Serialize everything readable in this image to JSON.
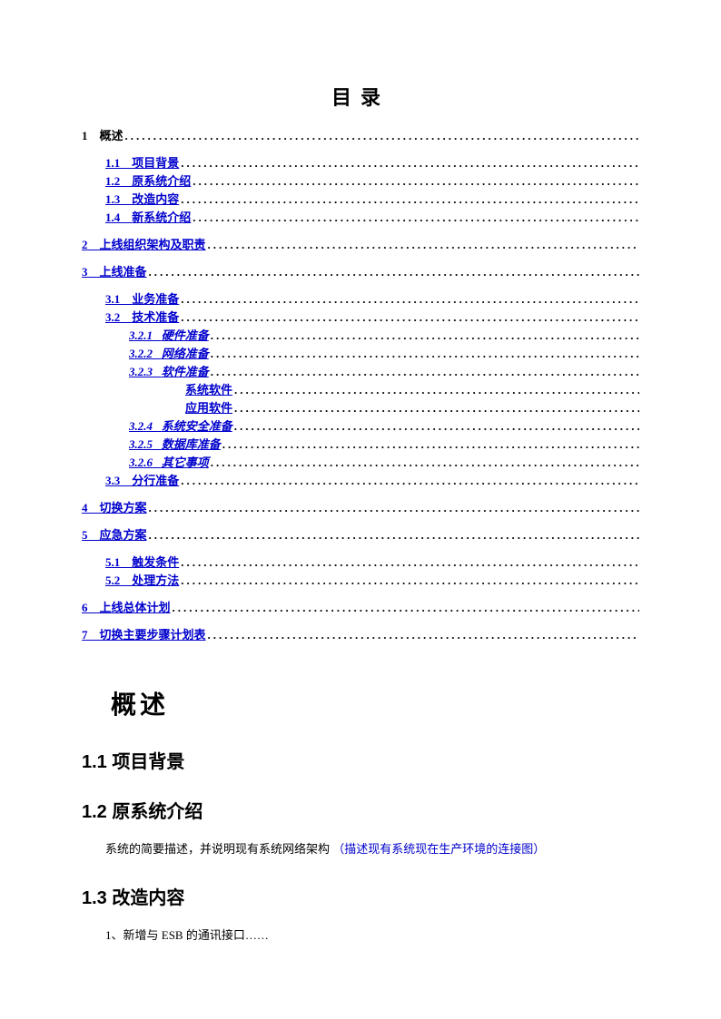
{
  "toc_title": "目录",
  "toc": [
    {
      "num": "1",
      "label": "概述",
      "indent": 0,
      "plain": true,
      "italic": false
    },
    {
      "num": "1.1",
      "label": "项目背景",
      "indent": 1,
      "plain": false,
      "italic": false,
      "spacer": true
    },
    {
      "num": "1.2",
      "label": "原系统介绍",
      "indent": 1,
      "plain": false,
      "italic": false
    },
    {
      "num": "1.3",
      "label": "改造内容",
      "indent": 1,
      "plain": false,
      "italic": false
    },
    {
      "num": "1.4",
      "label": "新系统介绍",
      "indent": 1,
      "plain": false,
      "italic": false
    },
    {
      "num": "2",
      "label": "上线组织架构及职责",
      "indent": 0,
      "plain": false,
      "italic": false,
      "spacer": true
    },
    {
      "num": "3",
      "label": "上线准备",
      "indent": 0,
      "plain": false,
      "italic": false,
      "spacer": true
    },
    {
      "num": "3.1",
      "label": "业务准备",
      "indent": 1,
      "plain": false,
      "italic": false,
      "spacer": true
    },
    {
      "num": "3.2",
      "label": "技术准备",
      "indent": 1,
      "plain": false,
      "italic": false
    },
    {
      "num": "3.2.1",
      "label": "硬件准备",
      "indent": 2,
      "plain": false,
      "italic": true
    },
    {
      "num": "3.2.2",
      "label": "网络准备",
      "indent": 2,
      "plain": false,
      "italic": true
    },
    {
      "num": "3.2.3",
      "label": "软件准备",
      "indent": 2,
      "plain": false,
      "italic": true
    },
    {
      "num": "",
      "label": "系统软件",
      "indent": 3,
      "plain": false,
      "italic": false
    },
    {
      "num": "",
      "label": "应用软件",
      "indent": 3,
      "plain": false,
      "italic": false
    },
    {
      "num": "3.2.4",
      "label": "系统安全准备",
      "indent": 2,
      "plain": false,
      "italic": true
    },
    {
      "num": "3.2.5",
      "label": "数据库准备",
      "indent": 2,
      "plain": false,
      "italic": true
    },
    {
      "num": "3.2.6",
      "label": "其它事项",
      "indent": 2,
      "plain": false,
      "italic": true
    },
    {
      "num": "3.3",
      "label": "分行准备",
      "indent": 1,
      "plain": false,
      "italic": false
    },
    {
      "num": "4",
      "label": "切换方案",
      "indent": 0,
      "plain": false,
      "italic": false,
      "spacer": true
    },
    {
      "num": "5",
      "label": "应急方案",
      "indent": 0,
      "plain": false,
      "italic": false,
      "spacer": true
    },
    {
      "num": "5.1",
      "label": "触发条件",
      "indent": 1,
      "plain": false,
      "italic": false,
      "spacer": true
    },
    {
      "num": "5.2",
      "label": "处理方法",
      "indent": 1,
      "plain": false,
      "italic": false
    },
    {
      "num": "6",
      "label": "上线总体计划",
      "indent": 0,
      "plain": false,
      "italic": false,
      "spacer": true
    },
    {
      "num": "7",
      "label": "切换主要步骤计划表",
      "indent": 0,
      "plain": false,
      "italic": false,
      "spacer": true
    }
  ],
  "sections": {
    "h1_overview": "概述",
    "h2_1_1": "1.1  项目背景",
    "h2_1_2": "1.2  原系统介绍",
    "p_1_2_a": "系统的简要描述，并说明现有系统网络架构",
    "p_1_2_b": "（描述现有系统现在生产环境的连接图）",
    "h2_1_3": "1.3  改造内容",
    "p_1_3": "1、新增与 ESB 的通讯接口……"
  }
}
